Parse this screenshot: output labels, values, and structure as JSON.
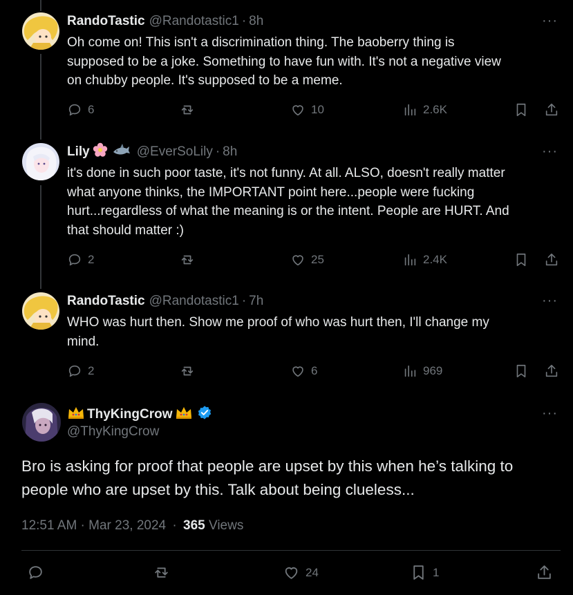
{
  "replies": [
    {
      "name": "RandoTastic",
      "handle": "@Randotastic1",
      "time": "8h",
      "lines": [
        "Oh come on! This isn't a discrimination thing. The baoberry thing is",
        "supposed to be a joke. Something to have fun with.  It's not a negative view",
        "on chubby people. It's supposed to be a meme."
      ],
      "replies": "6",
      "reposts": "",
      "likes": "10",
      "views": "2.6K"
    },
    {
      "name": "Lily",
      "handle": "@EverSoLily",
      "time": "8h",
      "lines": [
        "it's done in such poor taste, it's not funny. At all. ALSO, doesn't really matter",
        "what anyone thinks, the IMPORTANT point here...people were fucking",
        "hurt...regardless of what the meaning is or the intent. People are HURT. And",
        "that should matter :)"
      ],
      "replies": "2",
      "reposts": "",
      "likes": "25",
      "views": "2.4K"
    },
    {
      "name": "RandoTastic",
      "handle": "@Randotastic1",
      "time": "7h",
      "lines": [
        "WHO was hurt then. Show me proof of who was hurt then, I'll change my",
        "mind."
      ],
      "replies": "2",
      "reposts": "",
      "likes": "6",
      "views": "969"
    }
  ],
  "main": {
    "name": "ThyKingCrow",
    "handle": "@ThyKingCrow",
    "lines": [
      "Bro is asking for proof that people are upset by this when he’s talking to",
      "people who are upset by this. Talk about being clueless..."
    ],
    "timestamp": "12:51 AM · Mar 23, 2024",
    "views_count": "365",
    "views_label": "Views",
    "replies": "",
    "reposts": "",
    "likes": "24",
    "bookmarks": "1"
  },
  "separator": "·",
  "more_label": "···",
  "colors": {
    "background": "#000000",
    "text": "#e7e9ea",
    "muted": "#71767b",
    "verified": "#1d9bf0",
    "crown": "#f5b70a"
  },
  "icons": [
    "reply-icon",
    "repost-icon",
    "like-icon",
    "views-icon",
    "bookmark-icon",
    "share-icon",
    "verified-badge-icon",
    "crown-icon",
    "flower-icon",
    "shark-icon"
  ]
}
